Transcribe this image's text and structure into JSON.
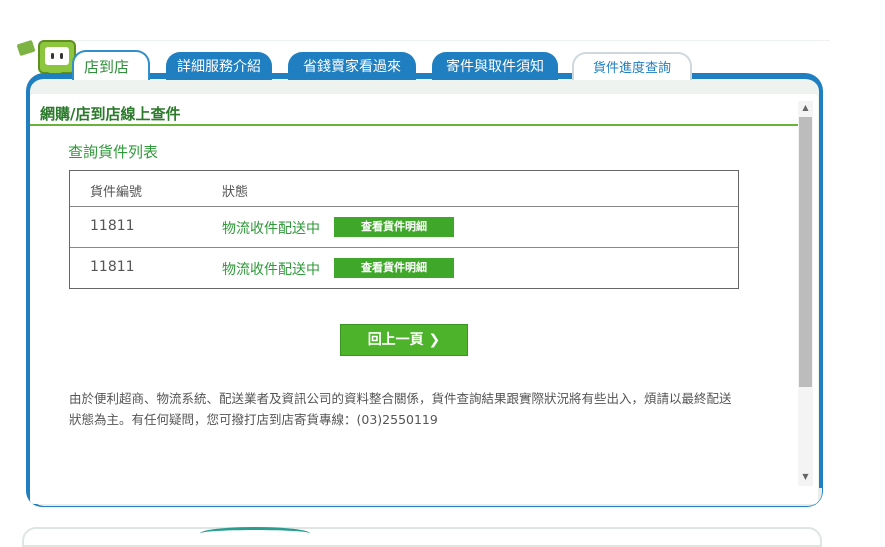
{
  "tabs": {
    "home": "店到店",
    "service": "詳細服務介紹",
    "sellers": "省錢賣家看過來",
    "rules": "寄件與取件須知",
    "tracking": "貨件進度查詢"
  },
  "section_title": "網購/店到店線上查件",
  "subtitle": "查詢貨件列表",
  "table": {
    "headers": {
      "number": "貨件編號",
      "status": "狀態"
    },
    "rows": [
      {
        "number": "11811",
        "status": "物流收件配送中",
        "button": "查看貨件明細"
      },
      {
        "number": "11811",
        "status": "物流收件配送中",
        "button": "查看貨件明細"
      }
    ]
  },
  "back_button": "回上一頁 ❯",
  "notice": "由於便利超商、物流系統、配送業者及資訊公司的資料整合關係，貨件查詢結果跟實際狀況將有些出入，煩請以最終配送狀態為主。有任何疑問，您可撥打店到店寄貨專線：(03)2550119",
  "colors": {
    "brand_green": "#2f9a3a",
    "tab_blue": "#1f7fc1",
    "button_green": "#3fa82a"
  },
  "icons": {
    "logo": "mascot-logo-icon",
    "scroll_up": "triangle-up-icon",
    "scroll_down": "triangle-down-icon"
  }
}
